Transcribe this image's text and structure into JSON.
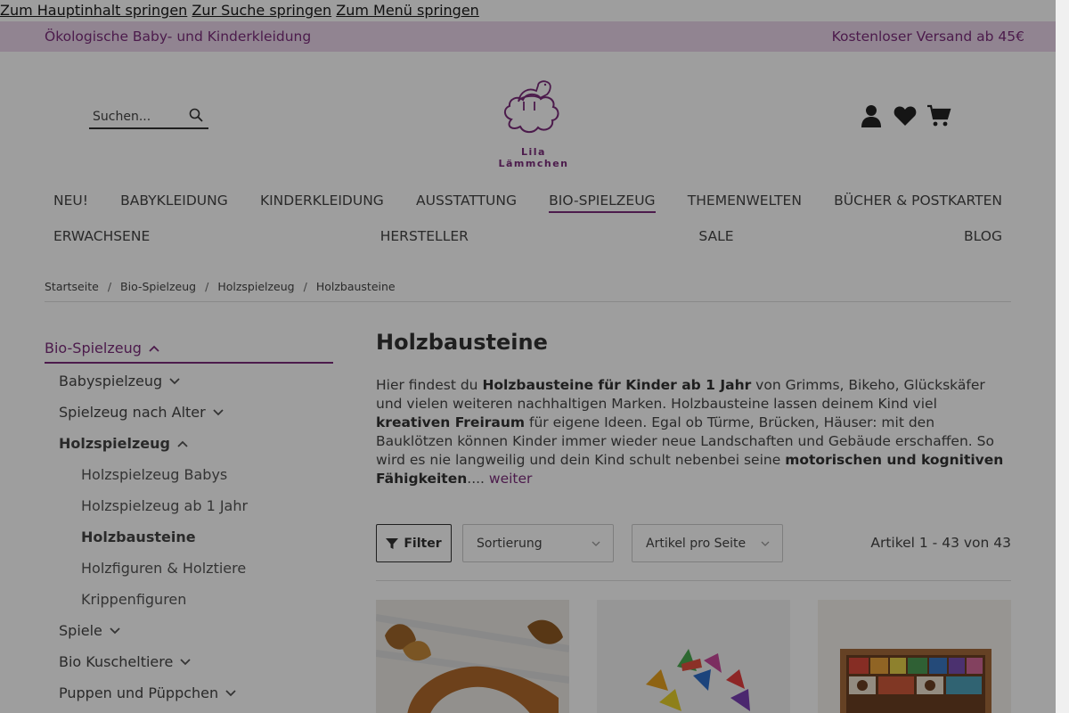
{
  "skip_links": [
    "Zum Hauptinhalt springen",
    "Zur Suche springen",
    "Zum Menü springen"
  ],
  "topbar": {
    "left": "Ökologische Baby- und Kinderkleidung",
    "right": "Kostenloser Versand ab 45€"
  },
  "search": {
    "placeholder": "Suchen..."
  },
  "logo": {
    "text": "Lila Lämmchen"
  },
  "header_icons": [
    "user-icon",
    "heart-icon",
    "cart-icon"
  ],
  "nav": {
    "row1": [
      "NEU!",
      "BABYKLEIDUNG",
      "KINDERKLEIDUNG",
      "AUSSTATTUNG",
      "BIO-SPIELZEUG",
      "THEMENWELTEN",
      "BÜCHER & POSTKARTEN"
    ],
    "row2": [
      "ERWACHSENE",
      "HERSTELLER",
      "SALE",
      "BLOG"
    ],
    "active": "BIO-SPIELZEUG"
  },
  "breadcrumb": [
    "Startseite",
    "Bio-Spielzeug",
    "Holzspielzeug",
    "Holzbausteine"
  ],
  "sidebar": {
    "top": "Bio-Spielzeug",
    "items": [
      {
        "label": "Babyspielzeug"
      },
      {
        "label": "Spielzeug nach Alter"
      },
      {
        "label": "Holzspielzeug"
      },
      {
        "label": "Holzspielzeug Babys"
      },
      {
        "label": "Holzspielzeug ab 1 Jahr"
      },
      {
        "label": "Holzbausteine"
      },
      {
        "label": "Holzfiguren & Holztiere"
      },
      {
        "label": "Krippenfiguren"
      },
      {
        "label": "Spiele"
      },
      {
        "label": "Bio Kuscheltiere"
      },
      {
        "label": "Puppen und Püppchen"
      }
    ]
  },
  "main": {
    "title": "Holzbausteine",
    "desc": {
      "p1": "Hier findest du ",
      "b1": "Holzbausteine für Kinder ab 1 Jahr",
      "p2": " von Grimms, Bikeho, Glückskäfer und vielen weiteren nachhaltigen Marken. Holzbausteine lassen deinem Kind viel ",
      "b2": "kreativen Freiraum",
      "p3": " für eigene Ideen. Egal ob Türme, Brücken, Häuser: mit den Bauklötzen können Kinder immer wieder neue Landschaften und Gebäude erschaffen. So wird es nie langweilig und dein Kind schult nebenbei seine ",
      "b3": "motorischen und kognitiven Fähigkeiten",
      "p4": "....",
      "more": " weiter"
    }
  },
  "toolbar": {
    "filter": "Filter",
    "sort": "Sortierung",
    "per_page": "Artikel pro Seite",
    "count": "Artikel 1 - 43 von 43"
  },
  "colors": {
    "brand": "#7b2d7b",
    "topbar_bg": "#ead6ea"
  }
}
